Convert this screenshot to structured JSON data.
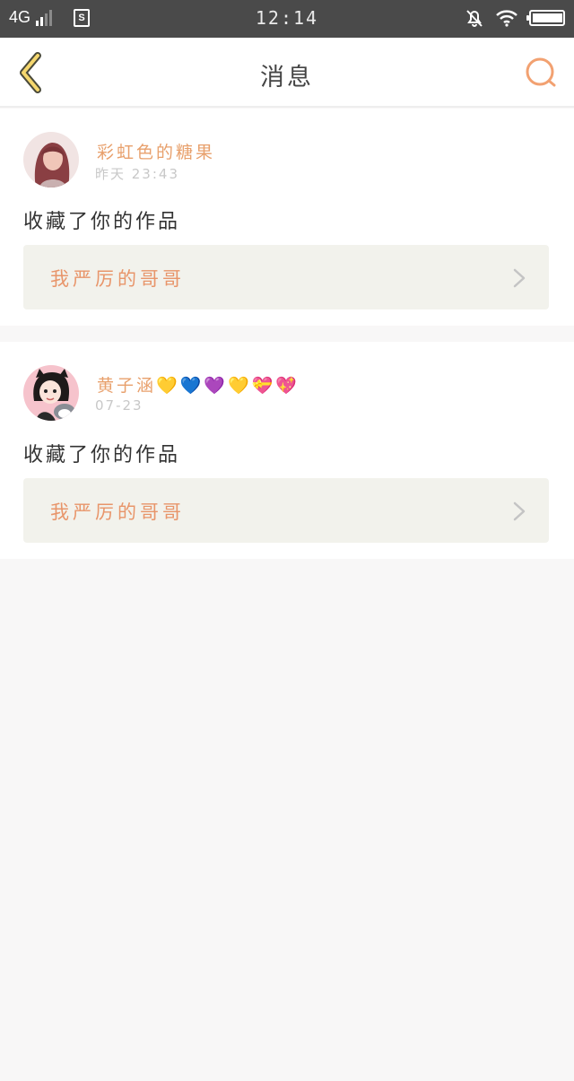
{
  "status_bar": {
    "network": "4G",
    "sim_icon_label": "S",
    "time": "12:14"
  },
  "header": {
    "title": "消息"
  },
  "messages": [
    {
      "username": "彩虹色的糖果",
      "time": "昨天 23:43",
      "action": "收藏了你的作品",
      "work_title": "我严厉的哥哥"
    },
    {
      "username": "黄子涵💛💙💜💛💝💖",
      "time": "07-23",
      "action": "收藏了你的作品",
      "work_title": "我严厉的哥哥"
    }
  ],
  "colors": {
    "accent": "#e8a06c",
    "status_bar": "#4a4a4a",
    "background": "#f8f7f7"
  }
}
